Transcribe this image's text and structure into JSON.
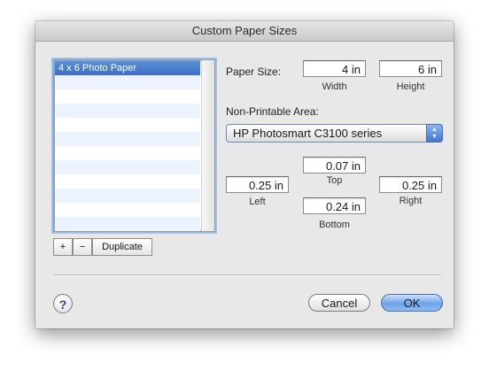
{
  "window": {
    "title": "Custom Paper Sizes"
  },
  "paper_list": {
    "items": [
      "4 x 6 Photo Paper",
      "",
      "",
      "",
      "",
      "",
      "",
      "",
      "",
      "",
      "",
      ""
    ]
  },
  "list_controls": {
    "add": "+",
    "remove": "−",
    "duplicate": "Duplicate"
  },
  "paper_size": {
    "label": "Paper Size:",
    "width_value": "4 in",
    "width_label": "Width",
    "height_value": "6 in",
    "height_label": "Height"
  },
  "non_printable": {
    "label": "Non-Printable Area:",
    "printer": "HP Photosmart C3100 series",
    "top_value": "0.07 in",
    "top_label": "Top",
    "left_value": "0.25 in",
    "left_label": "Left",
    "right_value": "0.25 in",
    "right_label": "Right",
    "bottom_value": "0.24 in",
    "bottom_label": "Bottom"
  },
  "buttons": {
    "help": "?",
    "cancel": "Cancel",
    "ok": "OK"
  }
}
